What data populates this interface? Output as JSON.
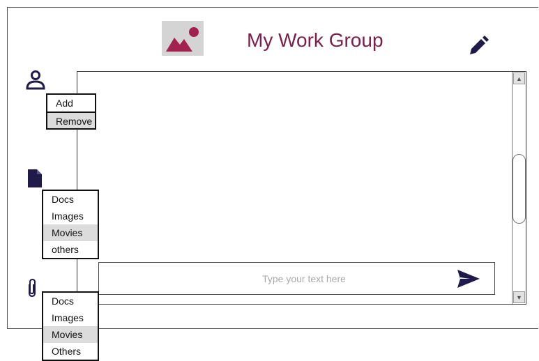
{
  "header": {
    "group_name": "My Work Group",
    "avatar_icon": "image-placeholder-icon",
    "edit_icon": "pencil-icon"
  },
  "chat": {
    "input_placeholder": "Type your text here",
    "input_value": "",
    "send_icon": "send-icon"
  },
  "members_menu": {
    "icon": "person-icon",
    "items": [
      {
        "label": "Add",
        "active": false
      },
      {
        "label": "Remove",
        "active": true
      }
    ]
  },
  "files_menu": {
    "icon": "document-icon",
    "items": [
      {
        "label": "Docs",
        "active": false
      },
      {
        "label": "Images",
        "active": false
      },
      {
        "label": "Movies",
        "active": true
      },
      {
        "label": "others",
        "active": false
      }
    ]
  },
  "attach_menu": {
    "icon": "paperclip-icon",
    "items": [
      {
        "label": "Docs",
        "active": false
      },
      {
        "label": "Images",
        "active": false
      },
      {
        "label": "Movies",
        "active": true
      },
      {
        "label": "Others",
        "active": false
      }
    ]
  },
  "colors": {
    "accent": "#7a1f4a",
    "icon_dark": "#1f1a4a"
  }
}
